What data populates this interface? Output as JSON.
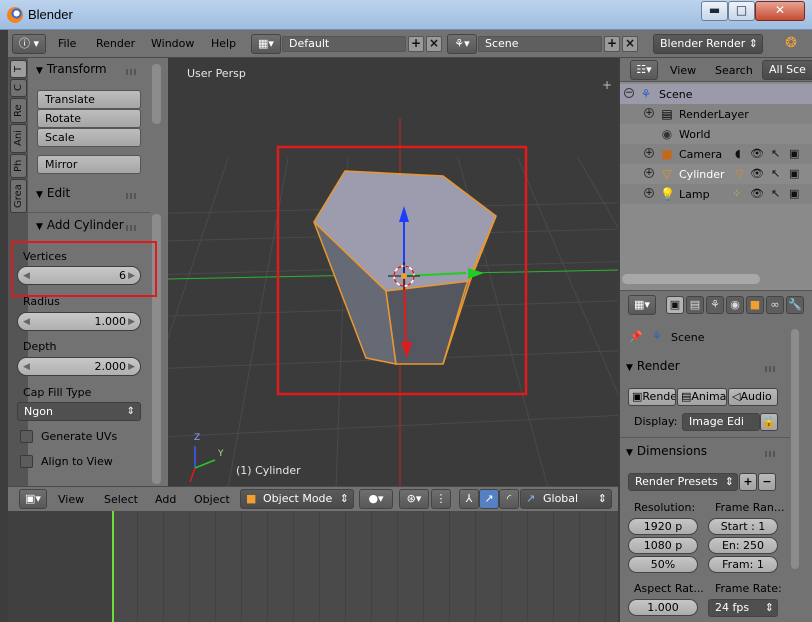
{
  "window": {
    "title": "Blender",
    "minimize": "▬",
    "maximize": "□",
    "close": "✕"
  },
  "header": {
    "menus": [
      "File",
      "Render",
      "Window",
      "Help"
    ],
    "screen_layout": "Default",
    "scene": "Scene",
    "render_engine": "Blender Render"
  },
  "tool_tabs": [
    "T",
    "C",
    "Re",
    "Ani",
    "Ph",
    "Grea"
  ],
  "tool_shelf": {
    "transform": {
      "title": "Transform",
      "buttons": [
        "Translate",
        "Rotate",
        "Scale",
        "Mirror"
      ]
    },
    "edit": {
      "title": "Edit"
    },
    "add_cylinder": {
      "title": "Add Cylinder",
      "vertices_label": "Vertices",
      "vertices": "6",
      "radius_label": "Radius",
      "radius": "1.000",
      "depth_label": "Depth",
      "depth": "2.000",
      "cap_fill_label": "Cap Fill Type",
      "cap_fill": "Ngon",
      "generate_uvs": "Generate UVs",
      "align_to_view": "Align to View"
    }
  },
  "viewport": {
    "view_label": "User Persp",
    "object_label": "(1) Cylinder",
    "axis_z": "Z",
    "axis_y": "Y"
  },
  "viewport_header": {
    "menus": [
      "View",
      "Select",
      "Add",
      "Object"
    ],
    "mode": "Object Mode",
    "orientation": "Global"
  },
  "outliner": {
    "menus": [
      "View",
      "Search",
      "All Sce"
    ],
    "items": [
      "Scene",
      "RenderLayer",
      "World",
      "Camera",
      "Cylinder",
      "Lamp"
    ]
  },
  "properties": {
    "context": "Scene",
    "render": {
      "title": "Render",
      "buttons": [
        "Rende",
        "Anima",
        "Audio"
      ],
      "display_label": "Display:",
      "display": "Image Edi"
    },
    "dimensions": {
      "title": "Dimensions",
      "presets": "Render Presets",
      "resolution_label": "Resolution:",
      "frame_range_label": "Frame Ran...",
      "res_x": "1920 p",
      "res_y": "1080 p",
      "res_pct": "50%",
      "start": "Start : 1",
      "end": "En: 250",
      "frame": "Fram: 1",
      "aspect_label": "Aspect Rat...",
      "frame_rate_label": "Frame Rate:",
      "aspect_x": "1.000",
      "fps": "24 fps"
    }
  },
  "colors": {
    "highlight_box": "#e01b1b",
    "axis_x": "#2bb52b",
    "axis_z": "#c62121",
    "gizmo_blue": "#1a3dff",
    "gizmo_red": "#e01b1b",
    "gizmo_green": "#22cc22",
    "selection_outline": "#e99831",
    "timeline_cursor": "#6fdc3a"
  }
}
